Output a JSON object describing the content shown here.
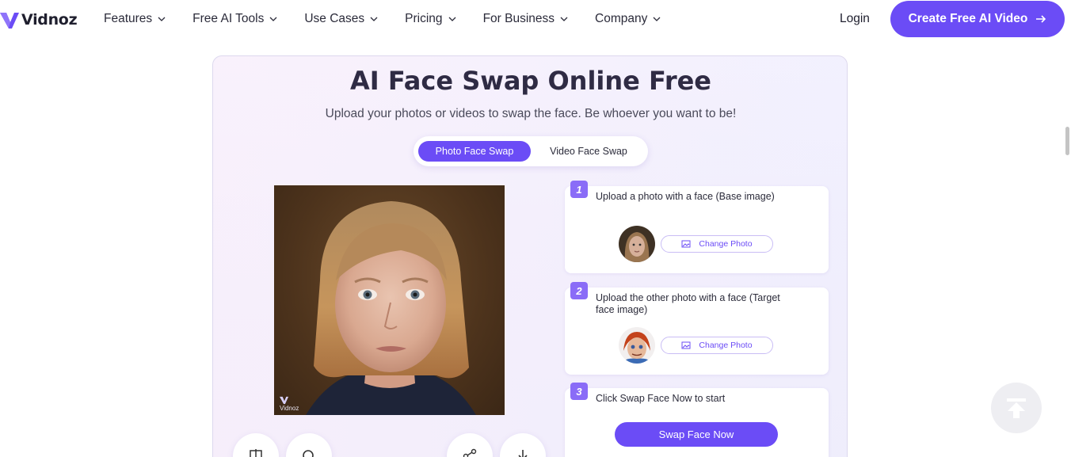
{
  "brand": {
    "logo_text": "Vidnoz",
    "accent_color": "#6b4cf6"
  },
  "nav": {
    "items": [
      {
        "label": "Features"
      },
      {
        "label": "Free AI Tools"
      },
      {
        "label": "Use Cases"
      },
      {
        "label": "Pricing"
      },
      {
        "label": "For Business"
      },
      {
        "label": "Company"
      }
    ],
    "login_label": "Login",
    "cta_label": "Create Free AI Video"
  },
  "main": {
    "title": "AI Face Swap Online Free",
    "subtitle": "Upload your photos or videos to swap the face. Be whoever you want to be!",
    "tabs": [
      {
        "label": "Photo Face Swap",
        "active": true
      },
      {
        "label": "Video Face Swap",
        "active": false
      }
    ],
    "preview": {
      "watermark": "Vidnoz"
    },
    "tools": [
      {
        "icon": "compare-icon"
      },
      {
        "icon": "zoom-icon"
      },
      {
        "icon": "share-icon"
      },
      {
        "icon": "download-icon"
      }
    ],
    "steps": [
      {
        "number": "1",
        "text": "Upload a photo with a face (Base image)",
        "button_label": "Change Photo"
      },
      {
        "number": "2",
        "text": "Upload the other photo with a face (Target face image)",
        "button_label": "Change Photo"
      },
      {
        "number": "3",
        "text": "Click Swap Face Now to start",
        "button_label": "Swap Face Now"
      }
    ]
  }
}
